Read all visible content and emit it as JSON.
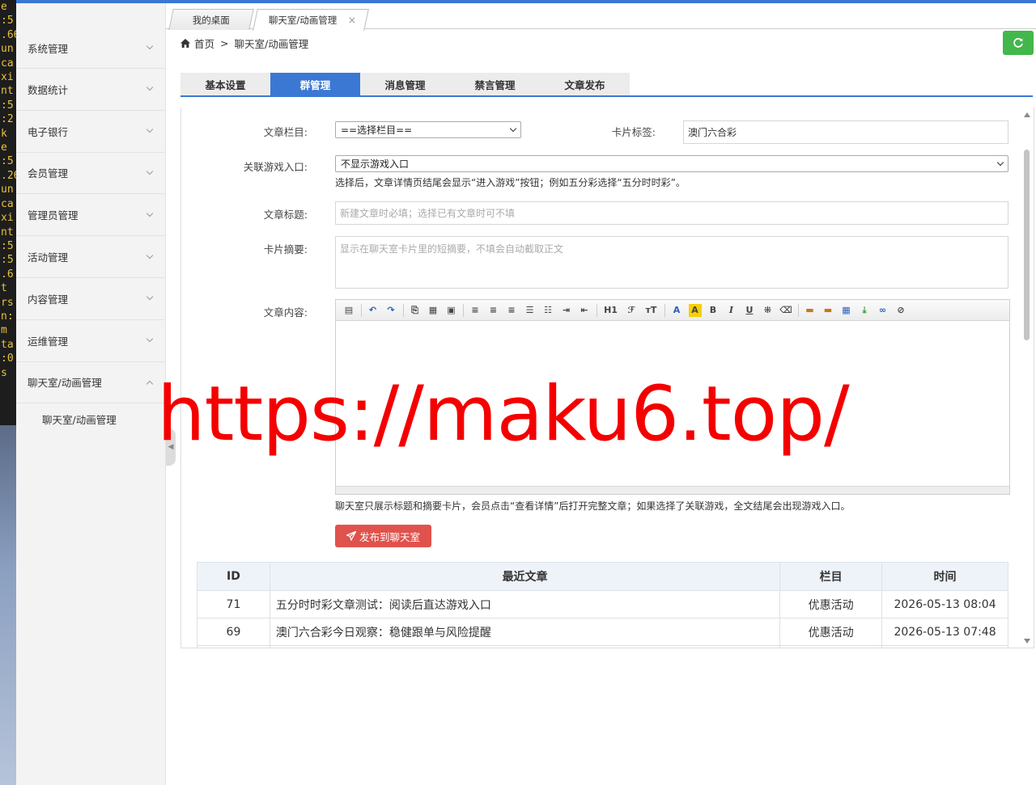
{
  "terminal_lines": [
    "e",
    ":5",
    ".66",
    "un",
    "ca",
    "xi",
    "nt",
    ":5",
    ":2",
    "k",
    "e",
    ":5",
    ".26",
    "un",
    "ca",
    "xi",
    "nt",
    ":5",
    ":5",
    ".6",
    "t",
    "rs",
    "n:",
    "m",
    "ta",
    ":0",
    "s"
  ],
  "sidebar": {
    "items": [
      {
        "label": "系统管理"
      },
      {
        "label": "数据统计"
      },
      {
        "label": "电子银行"
      },
      {
        "label": "会员管理"
      },
      {
        "label": "管理员管理"
      },
      {
        "label": "活动管理"
      },
      {
        "label": "内容管理"
      },
      {
        "label": "运维管理"
      },
      {
        "label": "聊天室/动画管理"
      }
    ],
    "sub_item": "聊天室/动画管理"
  },
  "page_tabs": {
    "home": "我的桌面",
    "current": "聊天室/动画管理",
    "close": "×"
  },
  "breadcrumb": {
    "home": "首页",
    "separator": ">",
    "current": "聊天室/动画管理"
  },
  "inner_tabs": [
    "基本设置",
    "群管理",
    "消息管理",
    "禁言管理",
    "文章发布"
  ],
  "form": {
    "category_label": "文章栏目:",
    "category_value": "==选择栏目==",
    "card_tag_label": "卡片标签:",
    "card_tag_value": "澳门六合彩",
    "game_label": "关联游戏入口:",
    "game_value": "不显示游戏入口",
    "game_hint": "选择后，文章详情页结尾会显示“进入游戏”按钮；例如五分彩选择“五分时时彩”。",
    "title_label": "文章标题:",
    "title_placeholder": "新建文章时必填；选择已有文章时可不填",
    "summary_label": "卡片摘要:",
    "summary_placeholder": "显示在聊天室卡片里的短摘要，不填会自动截取正文",
    "content_label": "文章内容:",
    "content_hint": "聊天室只展示标题和摘要卡片，会员点击“查看详情”后打开完整文章；如果选择了关联游戏，全文结尾会出现游戏入口。",
    "publish_button": "发布到聊天室"
  },
  "toolbar_glyphs": {
    "h1": "H1",
    "font": "ℱ",
    "size": "тT",
    "fontcolor": "A",
    "bgcolor": "A",
    "bold": "B",
    "italic": "I",
    "underline": "U"
  },
  "table": {
    "headers": [
      "ID",
      "最近文章",
      "栏目",
      "时间"
    ],
    "rows": [
      {
        "id": "71",
        "title": "五分时时彩文章测试：阅读后直达游戏入口",
        "category": "优惠活动",
        "time": "2026-05-13 08:04"
      },
      {
        "id": "69",
        "title": "澳门六合彩今日观察：稳健跟单与风险提醒",
        "category": "优惠活动",
        "time": "2026-05-13 07:48"
      }
    ]
  },
  "watermark": "https://maku6.top/",
  "colors": {
    "accent": "#3a78d4",
    "refresh": "#43b74b",
    "publish": "#e0524c",
    "watermark": "#f40000"
  }
}
